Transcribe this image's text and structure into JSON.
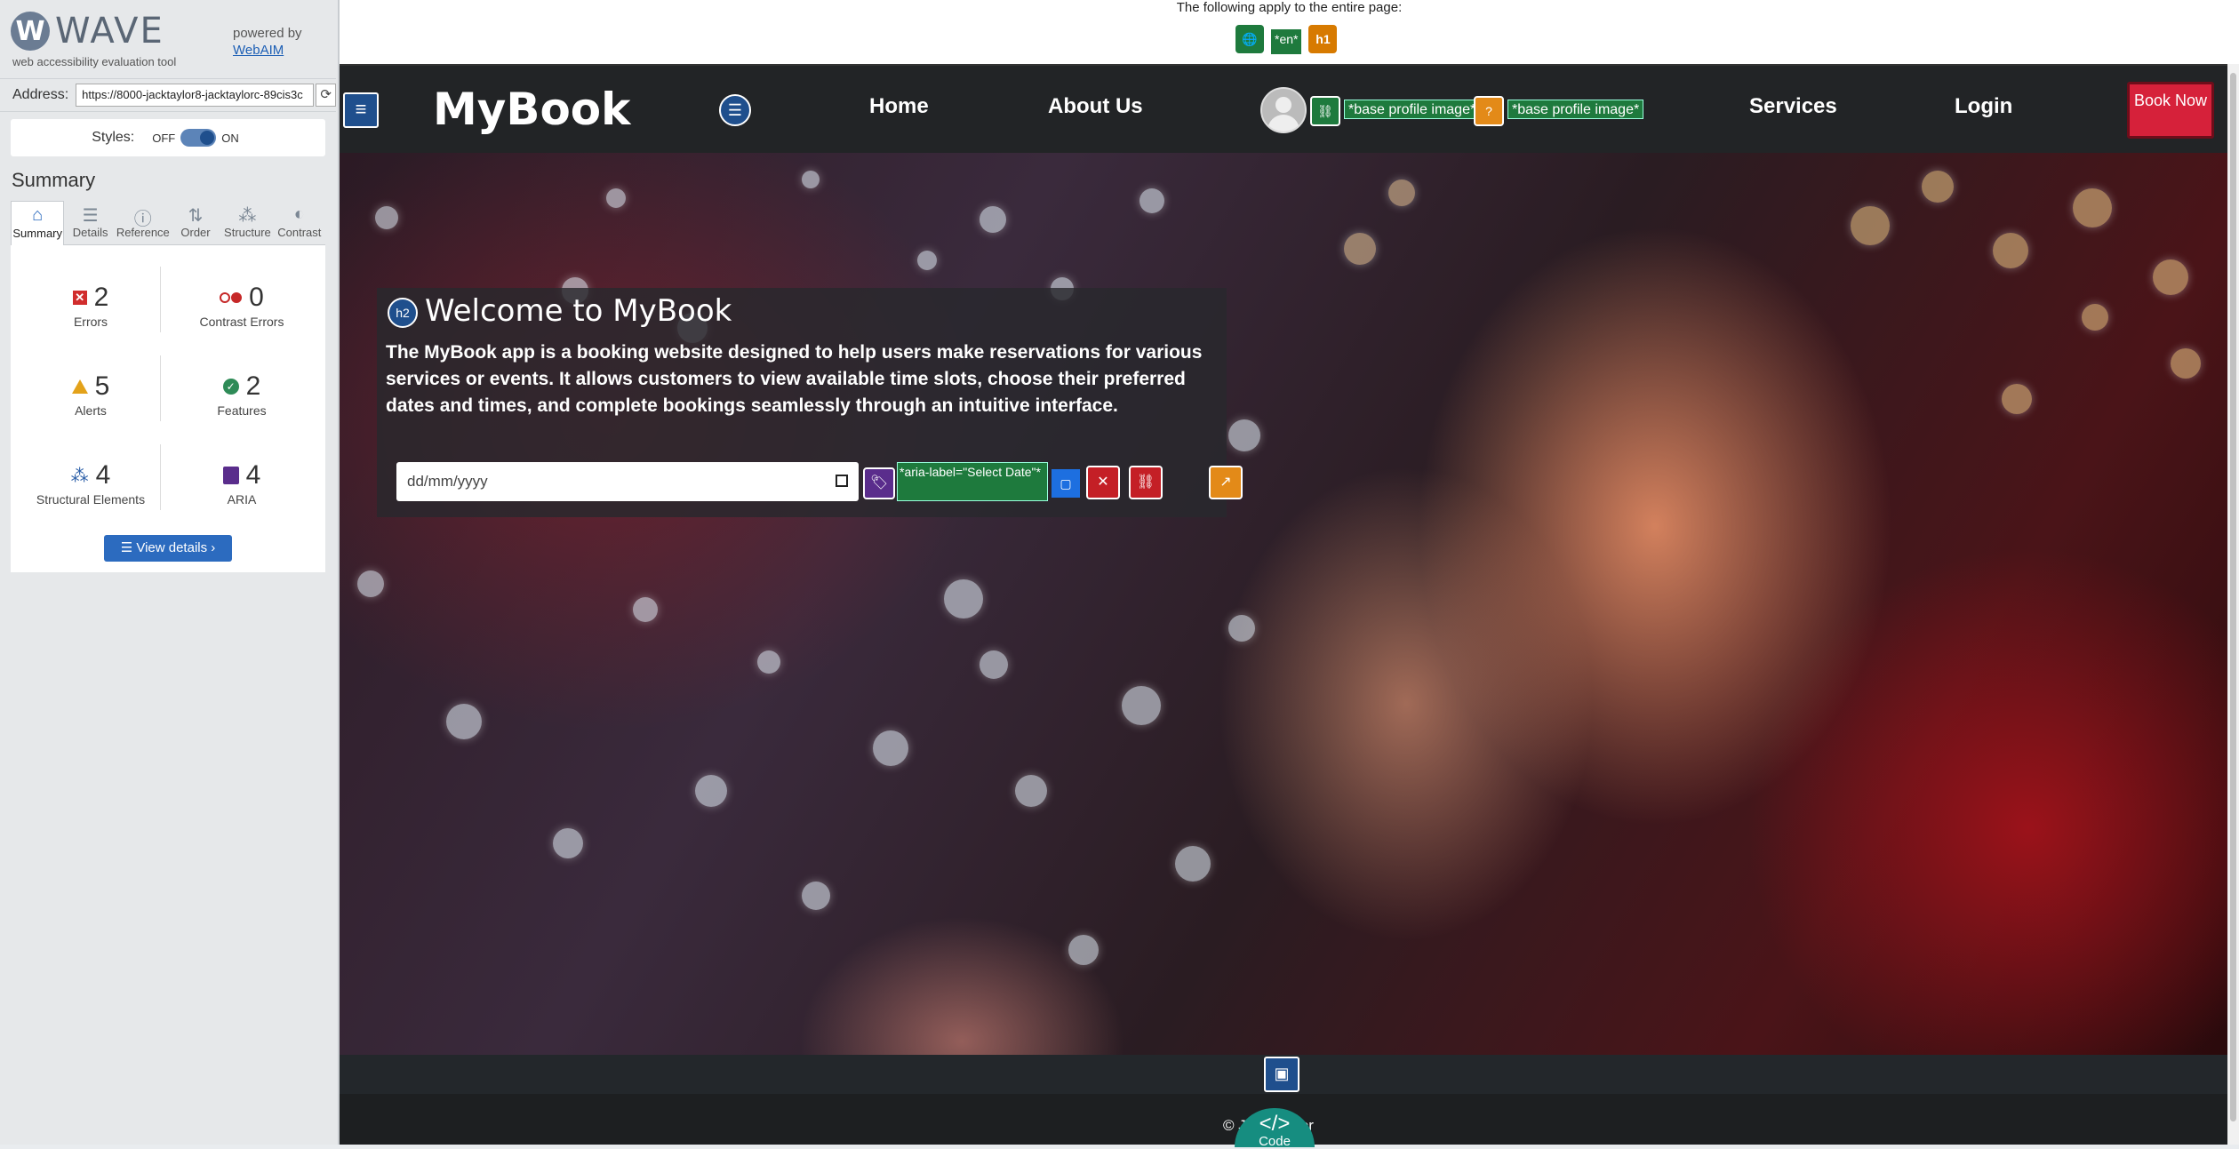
{
  "wave": {
    "logo_text": "WAVE",
    "tagline": "web accessibility evaluation tool",
    "powered_by": "powered by",
    "webaim": "WebAIM",
    "address_label": "Address:",
    "address_value": "https://8000-jacktaylor8-jacktaylorc-89cis3c",
    "styles_label": "Styles:",
    "styles_off": "OFF",
    "styles_on": "ON",
    "summary_title": "Summary",
    "tabs": [
      "Summary",
      "Details",
      "Reference",
      "Order",
      "Structure",
      "Contrast"
    ],
    "stats": {
      "errors": {
        "value": "2",
        "label": "Errors"
      },
      "contrast_errors": {
        "value": "0",
        "label": "Contrast Errors"
      },
      "alerts": {
        "value": "5",
        "label": "Alerts"
      },
      "features": {
        "value": "2",
        "label": "Features"
      },
      "structural": {
        "value": "4",
        "label": "Structural Elements"
      },
      "aria": {
        "value": "4",
        "label": "ARIA"
      }
    },
    "view_details": "View details ›"
  },
  "notice": {
    "text": "The following apply to the entire page:",
    "lang_badge": "*en*",
    "h1_badge": "h1"
  },
  "site": {
    "brand": "MyBook",
    "nav": {
      "home": "Home",
      "about": "About Us",
      "services": "Services",
      "login": "Login"
    },
    "alt_label_1": "*base profile image*",
    "alt_label_2": "*base profile image*",
    "book_now": "Book Now",
    "hero": {
      "h2_icon": "h2",
      "title": "Welcome to MyBook",
      "description": "The MyBook app is a booking website designed to help users make reservations for various services or events. It allows customers to view available time slots, choose their preferred dates and times, and complete bookings seamlessly through an intuitive interface.",
      "date_placeholder": "dd/mm/yyyy",
      "aria_label_text": "*aria-label=\"Select Date\"*"
    },
    "footer": {
      "copyright": "© Jack Taylor",
      "code_label": "Code",
      "code_glyph": "</>"
    }
  }
}
